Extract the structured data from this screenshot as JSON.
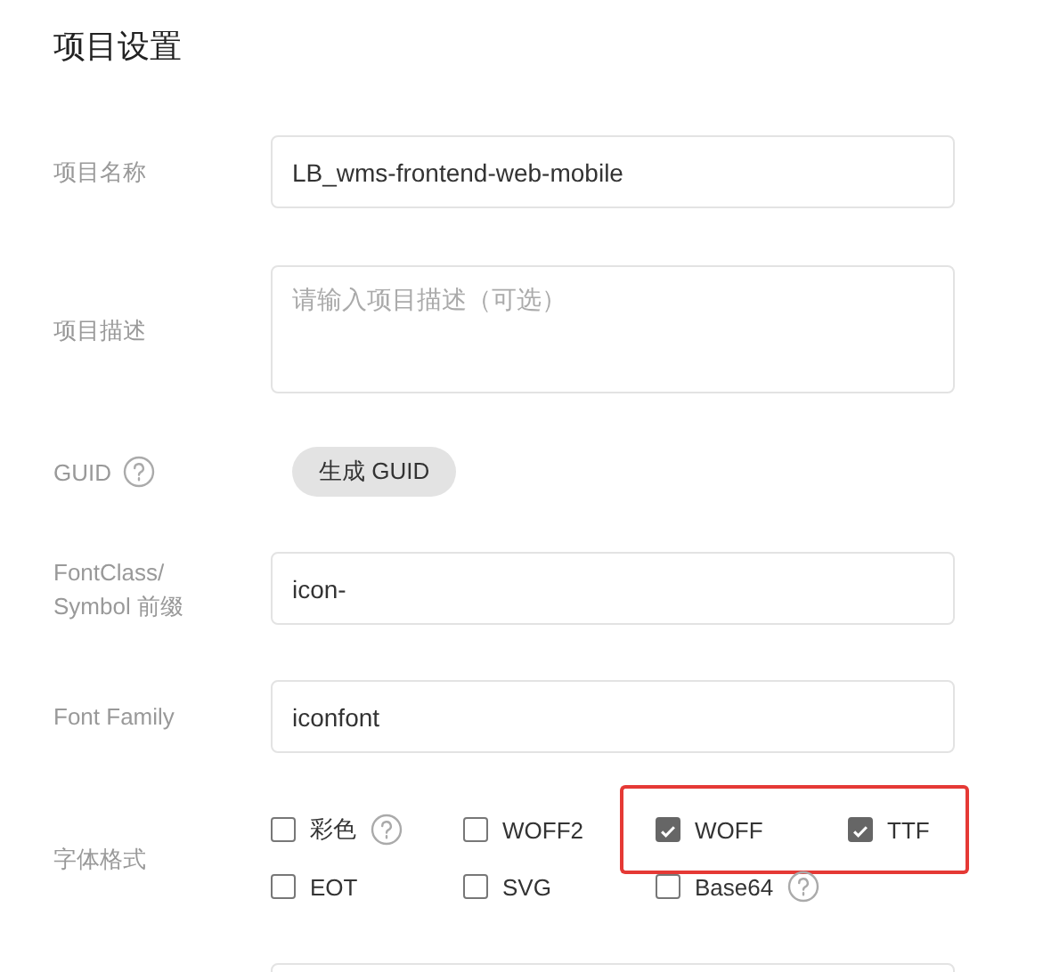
{
  "title": "项目设置",
  "fields": [
    {
      "kind": "input",
      "label": "项目名称",
      "value": "LB_wms-frontend-web-mobile"
    },
    {
      "kind": "textarea",
      "label": "项目描述",
      "placeholder": "请输入项目描述（可选）"
    },
    {
      "kind": "button",
      "label": "GUID",
      "help": true,
      "button": "生成 GUID"
    },
    {
      "kind": "input",
      "label": "FontClass/\nSymbol 前缀",
      "value": "icon-"
    },
    {
      "kind": "input",
      "label": "Font Family",
      "value": "iconfont"
    },
    {
      "kind": "checkboxes",
      "label": "字体格式",
      "options": [
        {
          "label": "彩色",
          "checked": false,
          "help": true,
          "highlighted": false
        },
        {
          "label": "WOFF2",
          "checked": false,
          "help": false,
          "highlighted": false
        },
        {
          "label": "WOFF",
          "checked": true,
          "help": false,
          "highlighted": true
        },
        {
          "label": "TTF",
          "checked": true,
          "help": false,
          "highlighted": true
        },
        {
          "label": "EOT",
          "checked": false,
          "help": false,
          "highlighted": false
        },
        {
          "label": "SVG",
          "checked": false,
          "help": false,
          "highlighted": false
        },
        {
          "label": "Base64",
          "checked": false,
          "help": true,
          "highlighted": false
        }
      ]
    },
    {
      "kind": "partial"
    }
  ]
}
